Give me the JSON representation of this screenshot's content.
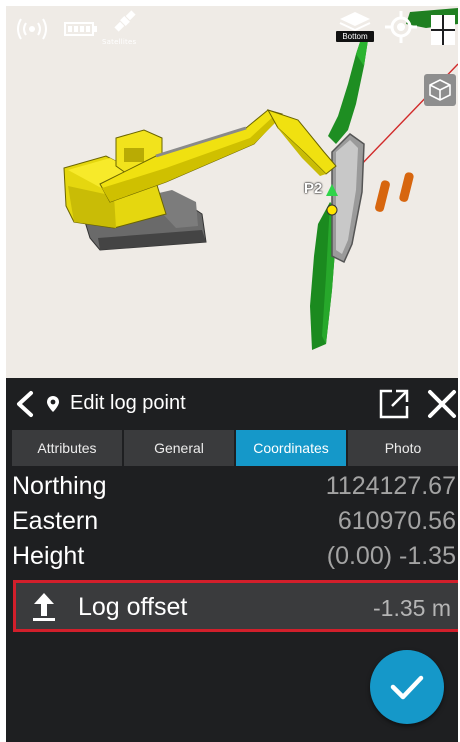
{
  "status_bar": {
    "icons": [
      "signal-icon",
      "battery-icon",
      "satellite-icon"
    ],
    "satellite_label": "Satellites"
  },
  "view_controls": {
    "layer_label": "Bottom",
    "icons": [
      "layers-icon",
      "target-icon",
      "layout-icon",
      "view-cube-icon"
    ]
  },
  "scene": {
    "point_label": "P2"
  },
  "panel": {
    "title": "Edit log point",
    "tabs": [
      {
        "label": "Attributes",
        "active": false
      },
      {
        "label": "General",
        "active": false
      },
      {
        "label": "Coordinates",
        "active": true
      },
      {
        "label": "Photo",
        "active": false
      }
    ],
    "coordinates": [
      {
        "label": "Northing",
        "value": "1124127.67"
      },
      {
        "label": "Eastern",
        "value": "610970.56"
      },
      {
        "label": "Height",
        "value": "(0.00) -1.35"
      }
    ],
    "log_offset": {
      "label": "Log offset",
      "value": "-1.35 m"
    }
  },
  "colors": {
    "accent": "#1598c9",
    "highlight_border": "#d21f2b",
    "panel_bg": "#1e1f21",
    "row_bg": "#3a3b3d",
    "viewport_bg": "#efebe6"
  }
}
